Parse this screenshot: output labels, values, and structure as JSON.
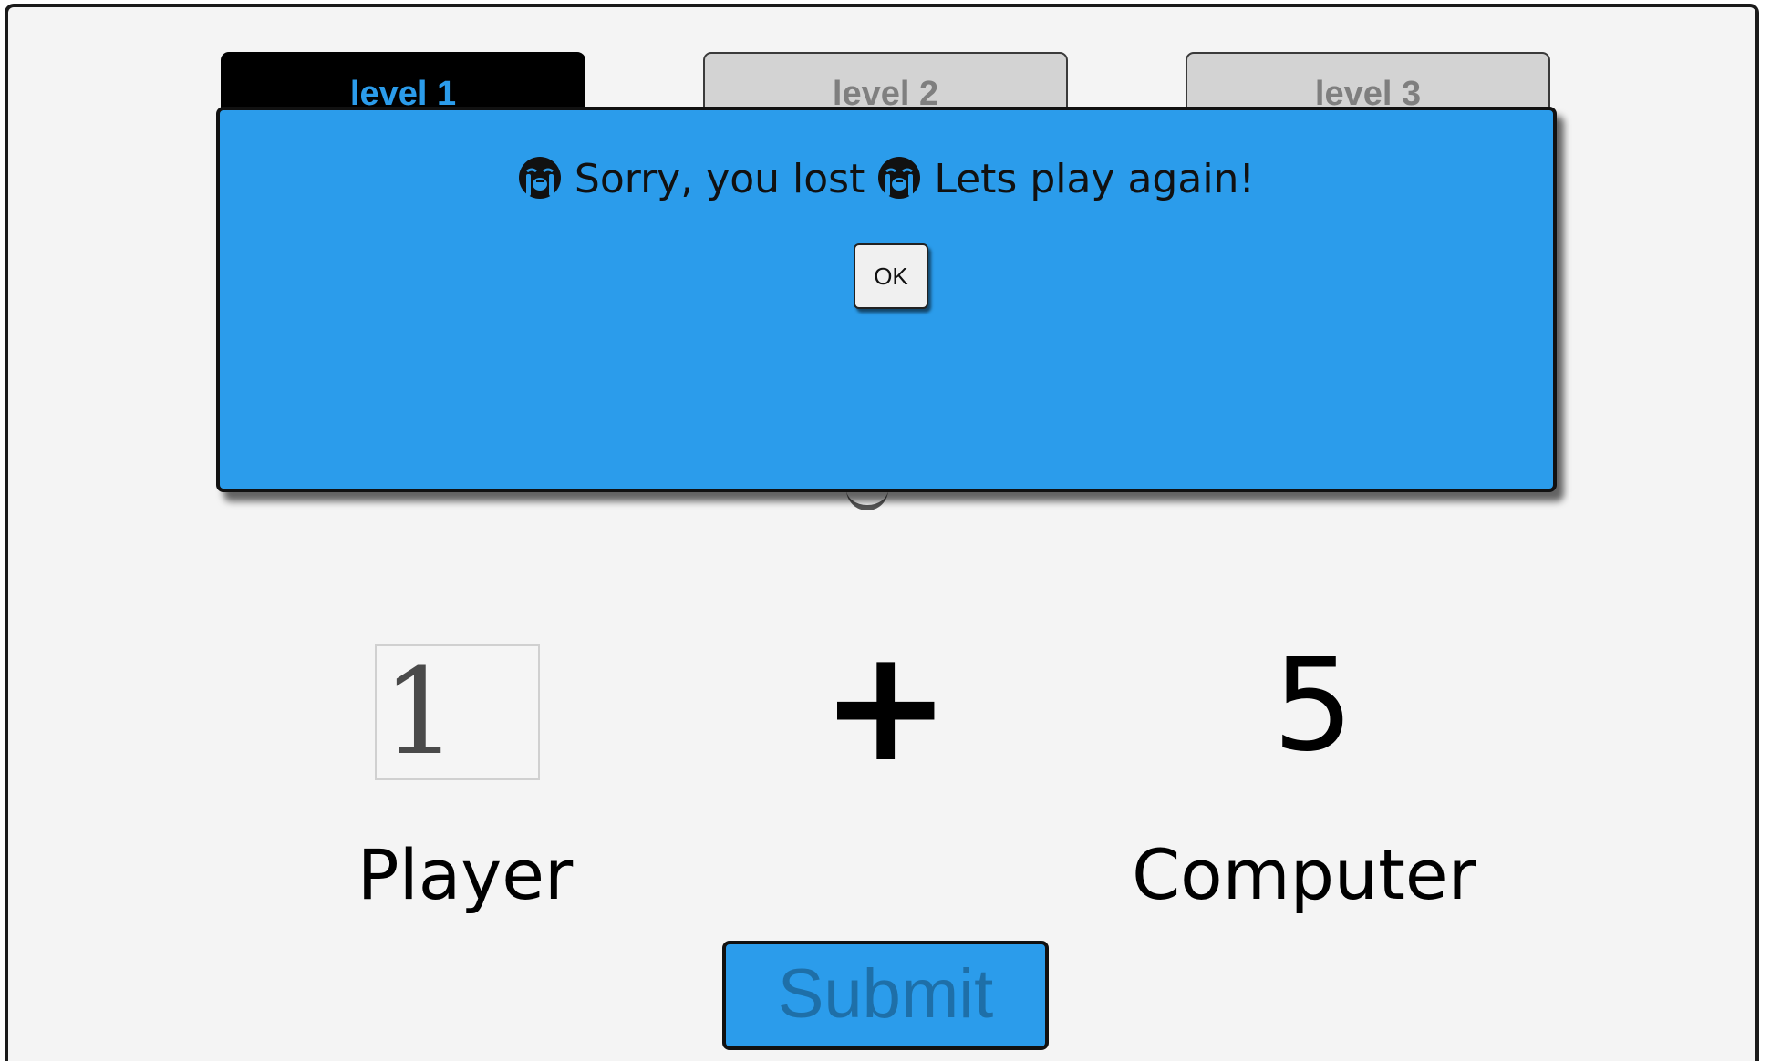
{
  "tabs": [
    {
      "label": "level 1",
      "active": true
    },
    {
      "label": "level 2",
      "active": false
    },
    {
      "label": "level 3",
      "active": false
    }
  ],
  "game": {
    "player_value": "1",
    "operator": "+",
    "computer_value": "5",
    "player_label": "Player",
    "computer_label": "Computer",
    "submit_label": "Submit"
  },
  "modal": {
    "message_part1": "Sorry, you lost",
    "message_part2": "Lets play again!",
    "icon": "crying-face-icon",
    "ok_label": "OK"
  },
  "colors": {
    "accent": "#2b9ceb",
    "tab_active_bg": "#000000",
    "tab_inactive_bg": "#d3d3d3",
    "page_bg": "#f4f4f4"
  }
}
